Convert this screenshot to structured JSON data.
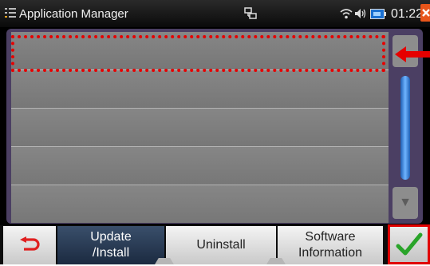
{
  "statusbar": {
    "title": "Application Manager",
    "time": "01:22",
    "icons": [
      "app-list-icon",
      "network-icon",
      "wifi-icon",
      "speaker-icon",
      "battery-icon",
      "close-icon"
    ]
  },
  "list": {
    "rows": [
      "",
      "",
      "",
      "",
      ""
    ],
    "selected_index": 0
  },
  "scrollbar": {
    "up_icon": "chevron-up-icon",
    "down_symbol": "▼"
  },
  "bottom": {
    "back_icon": "back-arrow-icon",
    "update_label": "Update\n/Install",
    "uninstall_label": "Uninstall",
    "info_label": "Software\nInformation",
    "ok_icon": "checkmark-icon"
  },
  "colors": {
    "highlight": "#e60000",
    "active_tab": "#2a3c55",
    "panel": "#4b3f63",
    "scroll_thumb": "#4a95ee"
  }
}
